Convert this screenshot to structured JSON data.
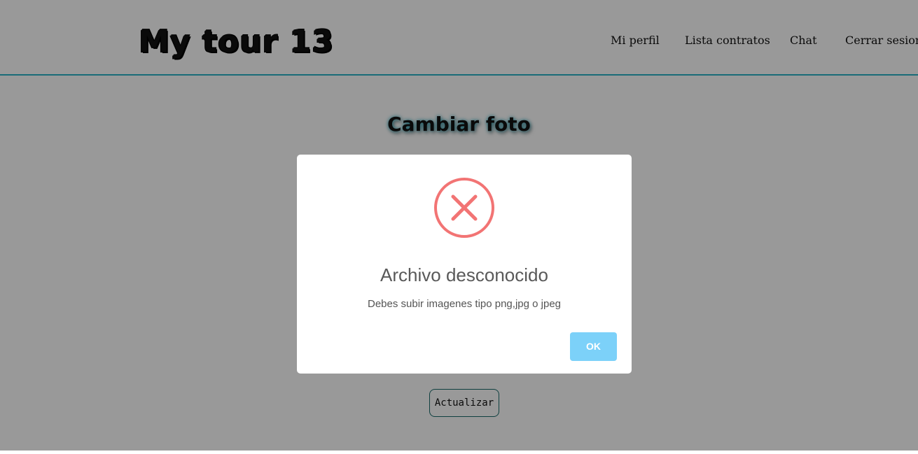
{
  "header": {
    "logo": "My tour 13",
    "nav": [
      {
        "label": "Mi perfil"
      },
      {
        "label": "Lista contratos"
      },
      {
        "label": "Chat"
      },
      {
        "label": "Cerrar sesion"
      }
    ]
  },
  "main": {
    "title": "Cambiar foto",
    "update_label": "Actualizar"
  },
  "modal": {
    "icon": "error-x-icon",
    "title": "Archivo desconocido",
    "text": "Debes subir imagenes tipo png,jpg o jpeg",
    "ok_label": "OK"
  },
  "colors": {
    "accent": "#2bb3c9",
    "error": "#f27474",
    "confirm": "#7cd1f9",
    "overlay": "#999999"
  }
}
